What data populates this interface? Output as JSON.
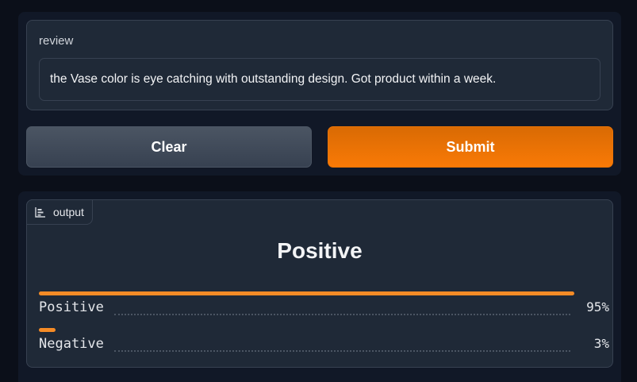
{
  "input": {
    "label": "review",
    "value": "the Vase color is eye catching with outstanding design. Got product within a week."
  },
  "buttons": {
    "clear": "Clear",
    "submit": "Submit"
  },
  "output": {
    "tag_label": "output",
    "tag_icon": "label-chart-icon",
    "result": "Positive",
    "accent_color": "#f58b26",
    "confidences": [
      {
        "label": "Positive",
        "value_text": "95%",
        "fraction": 0.95
      },
      {
        "label": "Negative",
        "value_text": "3%",
        "fraction": 0.03
      }
    ]
  }
}
